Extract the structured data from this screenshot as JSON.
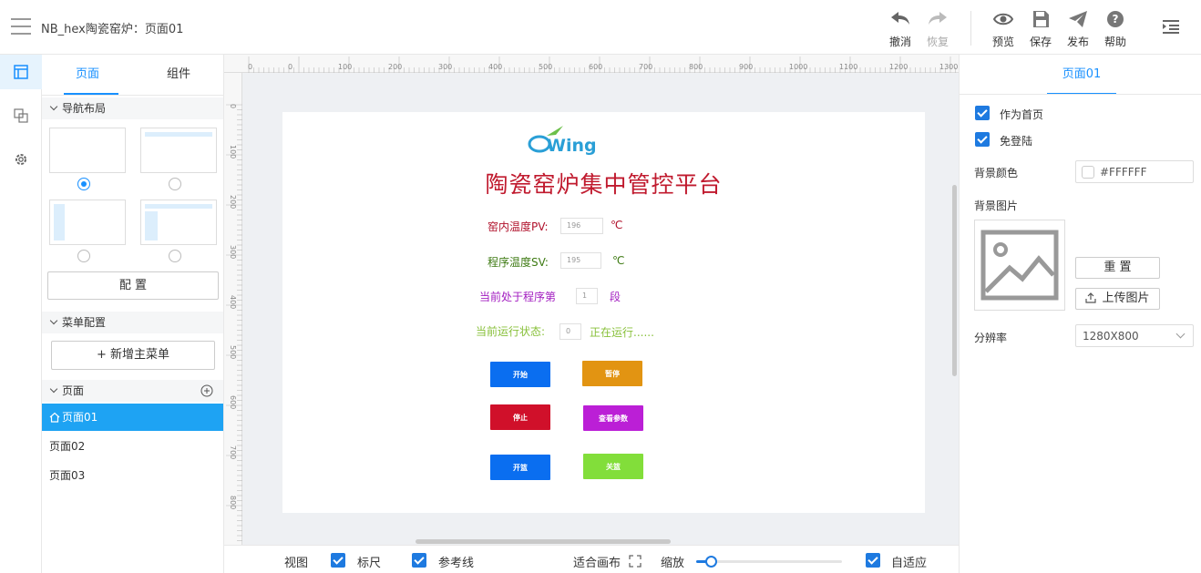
{
  "app": {
    "title": "NB_hex陶瓷窑炉：页面01"
  },
  "toolbar": {
    "undo": "撤消",
    "redo": "恢复",
    "preview": "预览",
    "save": "保存",
    "publish": "发布",
    "help": "帮助"
  },
  "left_panel": {
    "tabs": [
      "页面",
      "组件"
    ],
    "nav_section": "导航布局",
    "config_button": "配 置",
    "menu_section": "菜单配置",
    "add_menu_button": "+ 新增主菜单",
    "pages_section": "页面",
    "pages": [
      "页面01",
      "页面02",
      "页面03"
    ],
    "selected_layout": 0
  },
  "rulers": {
    "top": [
      "0",
      "0",
      "100",
      "200",
      "300",
      "400",
      "500",
      "600",
      "700",
      "800",
      "900",
      "1000",
      "1100",
      "1200",
      "1300"
    ],
    "left": [
      "0",
      "100",
      "200",
      "300",
      "400",
      "500",
      "600",
      "700",
      "800"
    ]
  },
  "canvas": {
    "logo_text": "Wing",
    "heading": "陶瓷窑炉集中管控平台",
    "fields": [
      {
        "label": "窑内温度PV:",
        "value": "196",
        "unit": "℃",
        "color": "#b0112b"
      },
      {
        "label": "程序温度SV:",
        "value": "195",
        "unit": "℃",
        "color": "#3d7a12"
      },
      {
        "label": "当前处于程序第",
        "value": "1",
        "unit": "段",
        "color": "#a21cc0"
      },
      {
        "label": "当前运行状态:",
        "value": "0",
        "unit": "正在运行......",
        "color": "#88c03a"
      }
    ],
    "buttons": [
      {
        "label": "开始",
        "color": "#0a6ef0"
      },
      {
        "label": "暂停",
        "color": "#e29412"
      },
      {
        "label": "停止",
        "color": "#d0102a"
      },
      {
        "label": "查看参数",
        "color": "#bb1fd6"
      },
      {
        "label": "开篮",
        "color": "#0a6ef0"
      },
      {
        "label": "关篮",
        "color": "#82de3a"
      }
    ]
  },
  "bottombar": {
    "view": "视图",
    "ruler": "标尺",
    "guides": "参考线",
    "fit": "适合画布",
    "zoom": "缩放",
    "adaptive": "自适应",
    "zoom_level": 0.1
  },
  "right_panel": {
    "title": "页面01",
    "as_homepage": "作为首页",
    "no_login": "免登陆",
    "bg_color_label": "背景颜色",
    "bg_color_value": "#FFFFFF",
    "bg_image_label": "背景图片",
    "reset_button": "重 置",
    "upload_button": "上传图片",
    "resolution_label": "分辨率",
    "resolution_value": "1280X800"
  }
}
